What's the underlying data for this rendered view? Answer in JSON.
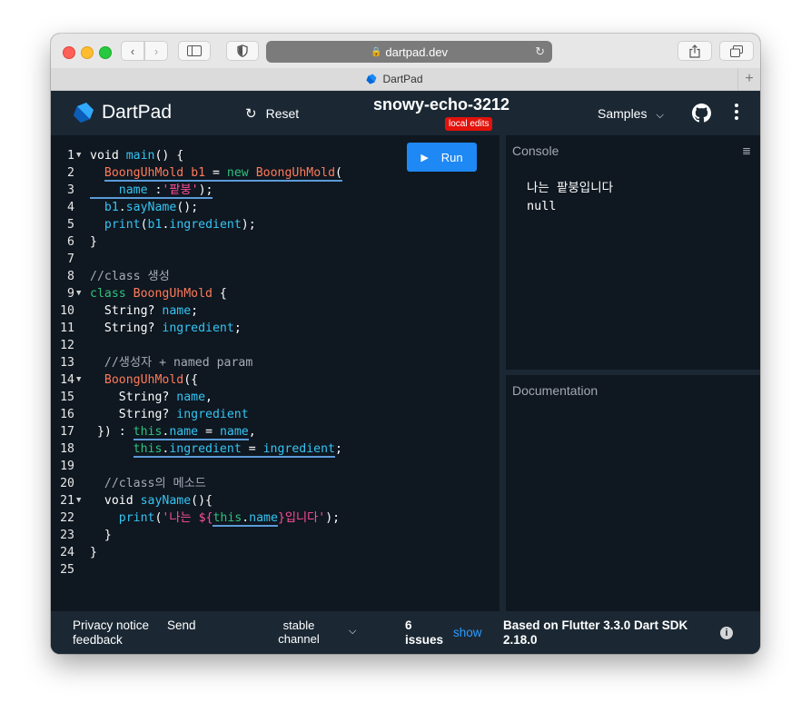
{
  "browser": {
    "url": "dartpad.dev",
    "tab_title": "DartPad"
  },
  "header": {
    "logo_text": "DartPad",
    "reset_label": "Reset",
    "project_title": "snowy-echo-3212",
    "badge": "local edits",
    "samples_label": "Samples"
  },
  "editor": {
    "run_label": "Run",
    "lines": [
      {
        "n": "1",
        "fold": true
      },
      {
        "n": "2",
        "fold": false
      },
      {
        "n": "3",
        "fold": false
      },
      {
        "n": "4",
        "fold": false
      },
      {
        "n": "5",
        "fold": false
      },
      {
        "n": "6",
        "fold": false
      },
      {
        "n": "7",
        "fold": false
      },
      {
        "n": "8",
        "fold": false
      },
      {
        "n": "9",
        "fold": true
      },
      {
        "n": "10",
        "fold": false
      },
      {
        "n": "11",
        "fold": false
      },
      {
        "n": "12",
        "fold": false
      },
      {
        "n": "13",
        "fold": false
      },
      {
        "n": "14",
        "fold": true
      },
      {
        "n": "15",
        "fold": false
      },
      {
        "n": "16",
        "fold": false
      },
      {
        "n": "17",
        "fold": false
      },
      {
        "n": "18",
        "fold": false
      },
      {
        "n": "19",
        "fold": false
      },
      {
        "n": "20",
        "fold": false
      },
      {
        "n": "21",
        "fold": true
      },
      {
        "n": "22",
        "fold": false
      },
      {
        "n": "23",
        "fold": false
      },
      {
        "n": "24",
        "fold": false
      },
      {
        "n": "25",
        "fold": false
      }
    ],
    "code": {
      "l1_a": "void ",
      "l1_b": "main",
      "l1_c": "() {",
      "l2_a": "  ",
      "l2_b": "BoongUhMold",
      "l2_c": " ",
      "l2_d": "b1",
      "l2_e": " = ",
      "l2_f": "new",
      "l2_g": " ",
      "l2_h": "BoongUhMold",
      "l2_i": "(",
      "l3_a": "    ",
      "l3_b": "name",
      "l3_c": " :",
      "l3_d": "'팥붕'",
      "l3_e": ");",
      "l4_a": "  ",
      "l4_b": "b1",
      "l4_c": ".",
      "l4_d": "sayName",
      "l4_e": "();",
      "l5_a": "  ",
      "l5_b": "print",
      "l5_c": "(",
      "l5_d": "b1",
      "l5_e": ".",
      "l5_f": "ingredient",
      "l5_g": ");",
      "l6": "}",
      "l8": "//class 생성",
      "l9_a": "class ",
      "l9_b": "BoongUhMold",
      "l9_c": " {",
      "l10_a": "  String? ",
      "l10_b": "name",
      "l10_c": ";",
      "l11_a": "  String? ",
      "l11_b": "ingredient",
      "l11_c": ";",
      "l13": "  //생성자 + named param",
      "l14_a": "  ",
      "l14_b": "BoongUhMold",
      "l14_c": "({",
      "l15_a": "    String? ",
      "l15_b": "name",
      "l15_c": ",",
      "l16_a": "    String? ",
      "l16_b": "ingredient",
      "l17_a": " }) : ",
      "l17_b": "this",
      "l17_c": ".",
      "l17_d": "name",
      "l17_e": " = ",
      "l17_f": "name",
      "l17_g": ",",
      "l18_a": "      ",
      "l18_b": "this",
      "l18_c": ".",
      "l18_d": "ingredient",
      "l18_e": " = ",
      "l18_f": "ingredient",
      "l18_g": ";",
      "l20": "  //class의 메소드",
      "l21_a": "  void ",
      "l21_b": "sayName",
      "l21_c": "(){",
      "l22_a": "    ",
      "l22_b": "print",
      "l22_c": "(",
      "l22_d": "'나는 ${",
      "l22_e": "this",
      "l22_f": ".",
      "l22_g": "name",
      "l22_h": "}입니다'",
      "l22_i": ");",
      "l23": "  }",
      "l24": "}"
    }
  },
  "console": {
    "title": "Console",
    "output": "나는 팥붕입니다\nnull"
  },
  "documentation": {
    "title": "Documentation"
  },
  "footer": {
    "privacy": "Privacy notice",
    "send": "Send",
    "feedback": "feedback",
    "channel_l1": "stable",
    "channel_l2": "channel",
    "issues_count": "6",
    "issues_label": "issues",
    "show": "show",
    "sdk_l1": "Based on Flutter 3.3.0 Dart SDK",
    "sdk_l2": "2.18.0"
  },
  "colors": {
    "accent": "#1e88f4",
    "badge": "#e3120b",
    "background": "#1b2834",
    "editor_bg": "#0f1720"
  }
}
